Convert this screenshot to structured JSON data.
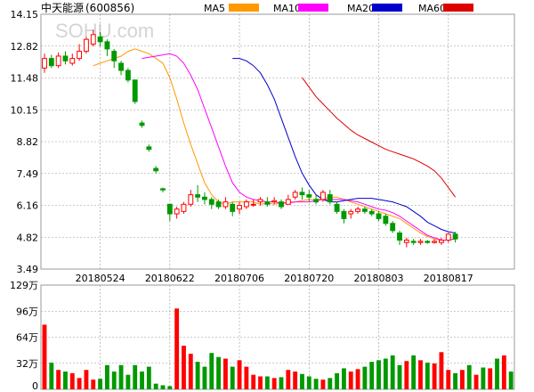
{
  "header": {
    "title": "中天能源",
    "code": "(600856)",
    "watermark": "SOHU.com"
  },
  "legend": [
    {
      "label": "MA5",
      "color": "#ff9900"
    },
    {
      "label": "MA10",
      "color": "#ff00ff"
    },
    {
      "label": "MA20",
      "color": "#0000cc"
    },
    {
      "label": "MA60",
      "color": "#dd0000"
    }
  ],
  "colors": {
    "up": "#ff0000",
    "down": "#009900",
    "grid": "#9a9a9a",
    "frame": "#9a9a9a"
  },
  "chart_data": [
    {
      "type": "candlestick",
      "title": "中天能源(600856)",
      "y_ticks": [
        "14.15",
        "12.82",
        "11.48",
        "10.15",
        "8.82",
        "7.49",
        "6.16",
        "4.82",
        "3.49"
      ],
      "ylim": [
        3.49,
        14.15
      ],
      "x_ticks": [
        "20180524",
        "20180622",
        "20180706",
        "20180720",
        "20180803",
        "20180817"
      ],
      "x_tick_index": [
        8,
        18,
        28,
        38,
        48,
        58
      ],
      "n_days": 68,
      "candles": [
        [
          11.9,
          12.3,
          12.5,
          11.7
        ],
        [
          12.3,
          12.0,
          12.45,
          11.9
        ],
        [
          12.0,
          12.4,
          12.55,
          11.9
        ],
        [
          12.4,
          12.2,
          12.6,
          12.05
        ],
        [
          12.1,
          12.3,
          12.5,
          12.0
        ],
        [
          12.3,
          12.6,
          12.9,
          12.2
        ],
        [
          12.6,
          13.1,
          13.2,
          12.5
        ],
        [
          12.9,
          13.3,
          13.5,
          12.8
        ],
        [
          13.2,
          13.0,
          13.4,
          12.8
        ],
        [
          13.0,
          12.7,
          13.1,
          12.4
        ],
        [
          12.6,
          12.2,
          12.7,
          11.9
        ],
        [
          12.1,
          11.8,
          12.2,
          11.6
        ],
        [
          11.8,
          11.4,
          11.9,
          11.3
        ],
        [
          11.4,
          10.5,
          11.4,
          10.4
        ],
        [
          9.6,
          9.5,
          9.7,
          9.4
        ],
        [
          8.6,
          8.5,
          8.7,
          8.4
        ],
        [
          7.7,
          7.6,
          7.8,
          7.5
        ],
        [
          6.85,
          6.8,
          6.9,
          6.7
        ],
        [
          6.2,
          5.8,
          6.2,
          5.5
        ],
        [
          5.8,
          6.0,
          6.1,
          5.6
        ],
        [
          5.9,
          6.2,
          6.3,
          5.8
        ],
        [
          6.2,
          6.6,
          6.8,
          6.1
        ],
        [
          6.6,
          6.5,
          7.0,
          6.3
        ],
        [
          6.5,
          6.4,
          6.7,
          6.2
        ],
        [
          6.4,
          6.2,
          6.5,
          6.0
        ],
        [
          6.3,
          6.1,
          6.4,
          6.0
        ],
        [
          6.1,
          6.3,
          6.5,
          6.0
        ],
        [
          6.2,
          5.9,
          6.3,
          5.7
        ],
        [
          6.0,
          6.15,
          6.3,
          5.8
        ],
        [
          6.1,
          6.3,
          6.4,
          6.0
        ],
        [
          6.2,
          6.2,
          6.4,
          6.1
        ],
        [
          6.3,
          6.4,
          6.5,
          6.15
        ],
        [
          6.3,
          6.2,
          6.5,
          6.1
        ],
        [
          6.3,
          6.35,
          6.5,
          6.2
        ],
        [
          6.3,
          6.1,
          6.4,
          6.0
        ],
        [
          6.2,
          6.4,
          6.6,
          6.2
        ],
        [
          6.5,
          6.7,
          6.8,
          6.4
        ],
        [
          6.7,
          6.6,
          6.9,
          6.4
        ],
        [
          6.6,
          6.5,
          6.8,
          6.3
        ],
        [
          6.4,
          6.3,
          6.6,
          6.2
        ],
        [
          6.4,
          6.7,
          6.8,
          6.3
        ],
        [
          6.6,
          6.3,
          6.8,
          6.2
        ],
        [
          6.2,
          5.9,
          6.3,
          5.8
        ],
        [
          5.9,
          5.6,
          6.0,
          5.4
        ],
        [
          5.8,
          5.9,
          6.0,
          5.6
        ],
        [
          5.9,
          6.0,
          6.1,
          5.8
        ],
        [
          6.0,
          5.9,
          6.1,
          5.8
        ],
        [
          5.9,
          5.8,
          6.0,
          5.7
        ],
        [
          5.8,
          5.6,
          5.9,
          5.5
        ],
        [
          5.7,
          5.4,
          5.8,
          5.3
        ],
        [
          5.4,
          5.1,
          5.5,
          5.0
        ],
        [
          5.0,
          4.7,
          5.1,
          4.5
        ],
        [
          4.6,
          4.7,
          4.8,
          4.4
        ],
        [
          4.65,
          4.6,
          4.75,
          4.5
        ],
        [
          4.6,
          4.65,
          4.75,
          4.5
        ],
        [
          4.65,
          4.6,
          4.7,
          4.55
        ],
        [
          4.6,
          4.65,
          4.75,
          4.55
        ],
        [
          4.6,
          4.7,
          4.8,
          4.5
        ],
        [
          4.7,
          4.95,
          5.0,
          4.6
        ],
        [
          4.95,
          4.75,
          5.05,
          4.6
        ]
      ],
      "ma_series": [
        {
          "name": "MA5",
          "values": [
            12.0,
            12.1,
            12.2,
            12.3,
            12.4,
            12.6,
            12.7,
            12.6,
            12.5,
            12.3,
            12.1,
            11.5,
            10.6,
            9.6,
            8.7,
            7.9,
            7.1,
            6.6,
            6.3,
            6.2,
            6.3,
            6.3,
            6.3,
            6.3,
            6.2,
            6.25,
            6.2,
            6.25,
            6.3,
            6.3,
            6.35,
            6.4,
            6.4,
            6.45,
            6.5,
            6.5,
            6.4,
            6.3,
            6.2,
            6.1,
            6.0,
            5.9,
            5.8,
            5.7,
            5.6,
            5.4,
            5.2,
            5.0,
            4.85,
            4.75,
            4.7,
            4.7,
            4.75
          ]
        },
        {
          "name": "MA10",
          "values": [
            12.3,
            12.35,
            12.4,
            12.45,
            12.5,
            12.4,
            12.1,
            11.6,
            11.0,
            10.2,
            9.4,
            8.6,
            7.8,
            7.1,
            6.7,
            6.5,
            6.4,
            6.35,
            6.3,
            6.3,
            6.25,
            6.25,
            6.3,
            6.3,
            6.3,
            6.35,
            6.4,
            6.4,
            6.4,
            6.4,
            6.35,
            6.3,
            6.2,
            6.1,
            6.0,
            5.95,
            5.85,
            5.7,
            5.5,
            5.3,
            5.1,
            4.9,
            4.8,
            4.7,
            4.7,
            4.75
          ]
        },
        {
          "name": "MA20",
          "values": [
            12.3,
            12.3,
            12.2,
            12.0,
            11.7,
            11.2,
            10.6,
            9.8,
            9.0,
            8.2,
            7.5,
            7.0,
            6.6,
            6.4,
            6.3,
            6.3,
            6.35,
            6.4,
            6.45,
            6.45,
            6.45,
            6.4,
            6.35,
            6.3,
            6.2,
            6.1,
            5.9,
            5.7,
            5.45,
            5.3,
            5.15,
            5.05,
            5.0
          ]
        },
        {
          "name": "MA60",
          "values": [
            11.5,
            11.1,
            10.7,
            10.4,
            10.1,
            9.8,
            9.55,
            9.3,
            9.1,
            8.95,
            8.8,
            8.65,
            8.5,
            8.4,
            8.3,
            8.2,
            8.1,
            7.95,
            7.8,
            7.6,
            7.3,
            6.9,
            6.5
          ]
        }
      ],
      "ma_start": [
        7,
        14,
        27,
        37
      ]
    },
    {
      "type": "bar",
      "title": "",
      "y_ticks": [
        "129万",
        "96万",
        "64万",
        "32万",
        "0"
      ],
      "ylim": [
        0,
        129
      ],
      "values": [
        80,
        33,
        24,
        22,
        20,
        14,
        24,
        12,
        13,
        30,
        22,
        30,
        18,
        30,
        22,
        28,
        7,
        5,
        4,
        100,
        54,
        44,
        34,
        28,
        45,
        40,
        38,
        28,
        36,
        28,
        18,
        16,
        16,
        14,
        15,
        24,
        22,
        19,
        16,
        13,
        12,
        14,
        20,
        26,
        22,
        25,
        28,
        34,
        36,
        38,
        42,
        30,
        35,
        42,
        36,
        33,
        32,
        46,
        24,
        20,
        24,
        30,
        18,
        27,
        26,
        38,
        42,
        22
      ]
    }
  ]
}
